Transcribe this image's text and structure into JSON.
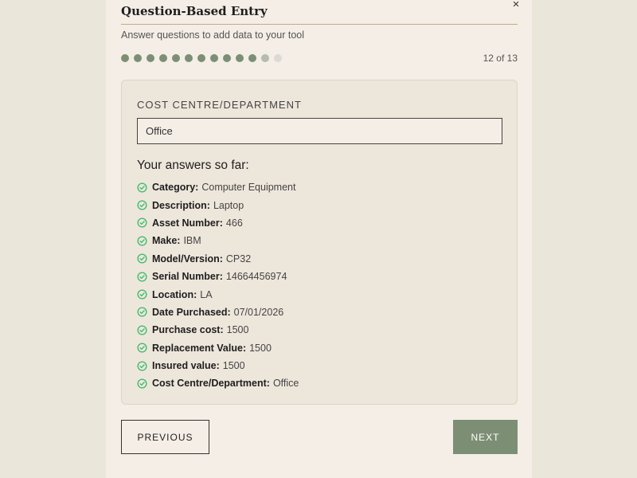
{
  "dialog": {
    "title": "Question-Based Entry",
    "close_label": "×",
    "subtitle": "Answer questions to add data to your tool"
  },
  "progress": {
    "current": 12,
    "total": 13,
    "label": "12 of 13",
    "dots": [
      "done",
      "done",
      "done",
      "done",
      "done",
      "done",
      "done",
      "done",
      "done",
      "done",
      "done",
      "current",
      "pending"
    ]
  },
  "question": {
    "label": "COST CENTRE/DEPARTMENT",
    "value": "Office"
  },
  "answers": {
    "heading": "Your answers so far:",
    "items": [
      {
        "key": "Category:",
        "value": "Computer Equipment"
      },
      {
        "key": "Description:",
        "value": "Laptop"
      },
      {
        "key": "Asset Number:",
        "value": "466"
      },
      {
        "key": "Make:",
        "value": "IBM"
      },
      {
        "key": "Model/Version:",
        "value": "CP32"
      },
      {
        "key": "Serial Number:",
        "value": "14664456974"
      },
      {
        "key": "Location:",
        "value": "LA"
      },
      {
        "key": "Date Purchased:",
        "value": "07/01/2026"
      },
      {
        "key": "Purchase cost:",
        "value": "1500"
      },
      {
        "key": "Replacement Value:",
        "value": "1500"
      },
      {
        "key": "Insured value:",
        "value": "1500"
      },
      {
        "key": "Cost Centre/Department:",
        "value": "Office"
      }
    ]
  },
  "buttons": {
    "previous": "PREVIOUS",
    "next": "NEXT"
  },
  "colors": {
    "accent": "#7c8f74",
    "check": "#3bb86a",
    "rule": "#c9a885"
  },
  "icons": {
    "close": "close-icon",
    "answer_check": "check-circle-icon"
  }
}
